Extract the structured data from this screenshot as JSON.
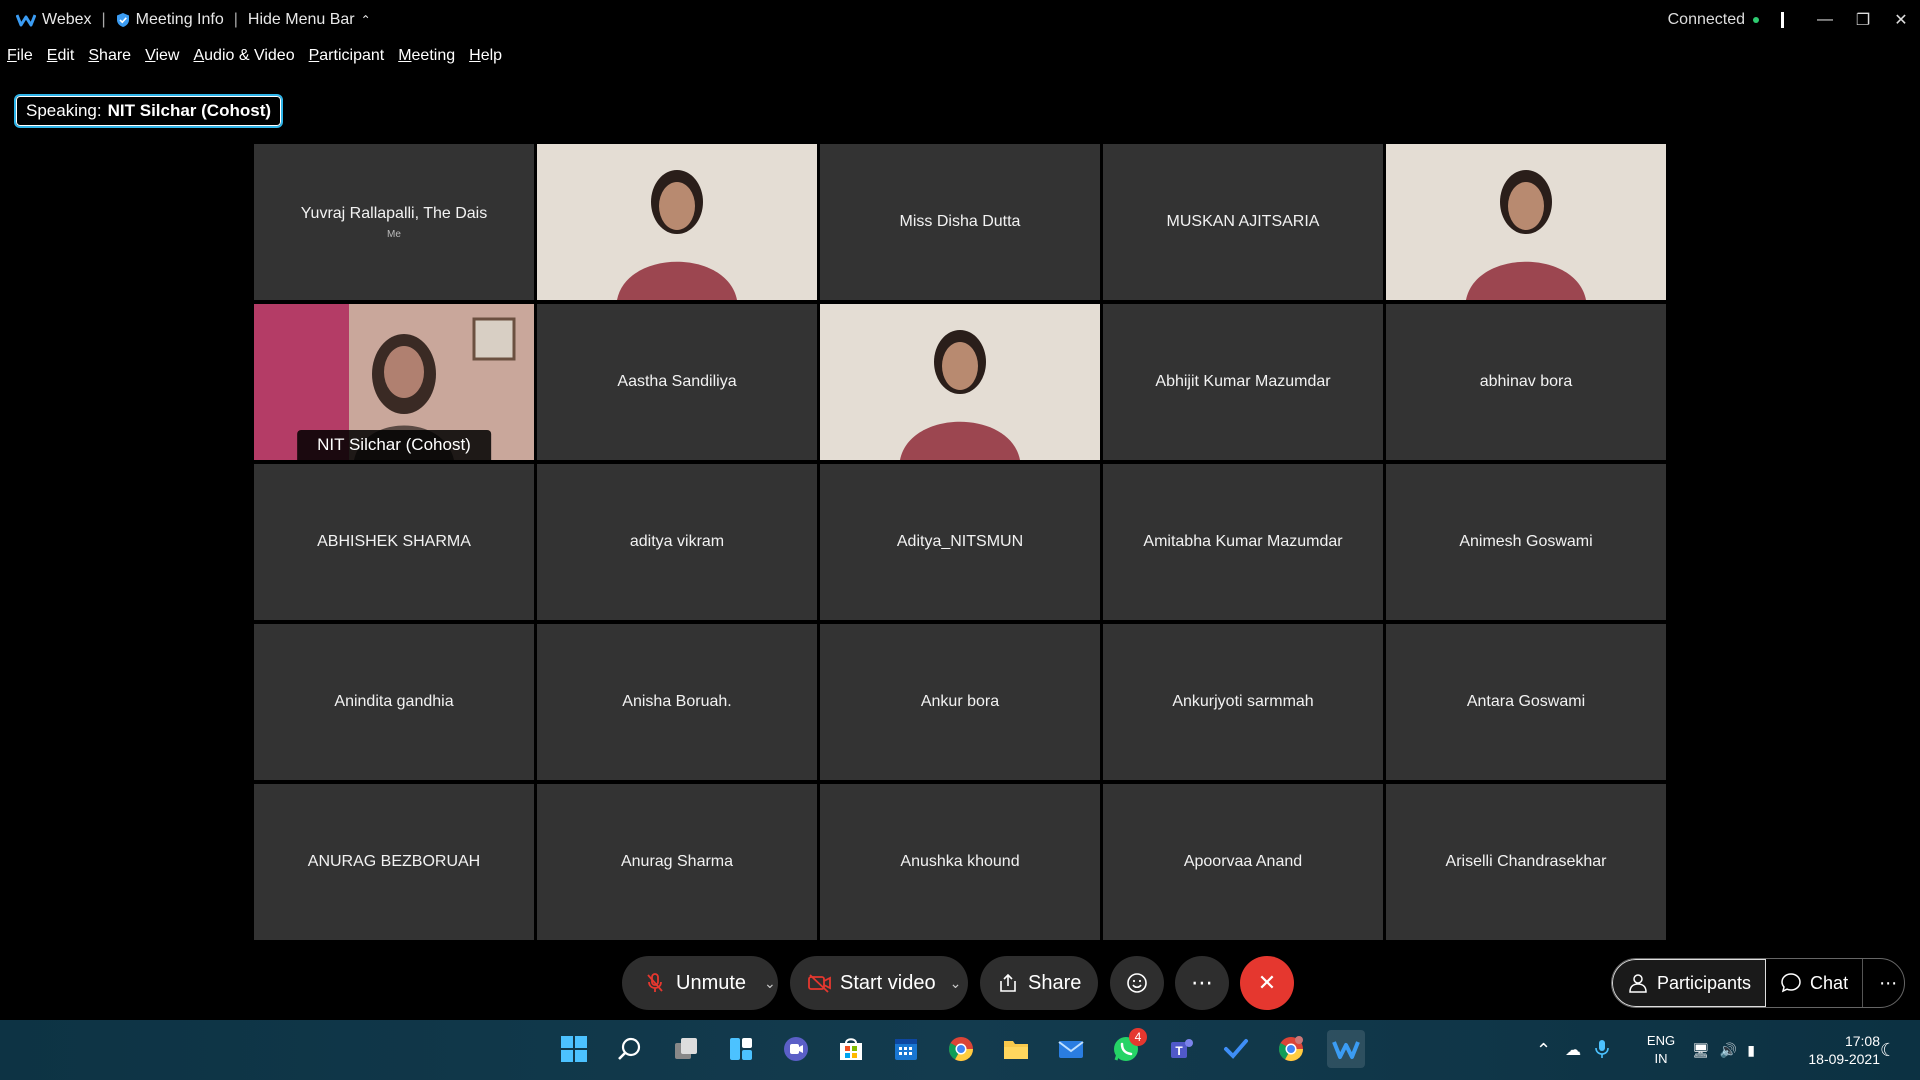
{
  "titlebar": {
    "app": "Webex",
    "meeting_info": "Meeting Info",
    "hide_menu": "Hide Menu Bar",
    "status": "Connected"
  },
  "menu": [
    "File",
    "Edit",
    "Share",
    "View",
    "Audio & Video",
    "Participant",
    "Meeting",
    "Help"
  ],
  "speaking": {
    "label": "Speaking:",
    "name": "NIT Silchar (Cohost)"
  },
  "tiles": [
    {
      "name": "Yuvraj Rallapalli, The Dais",
      "sub": "Me"
    },
    {
      "name": "",
      "video": true
    },
    {
      "name": "Miss Disha Dutta"
    },
    {
      "name": "MUSKAN AJITSARIA"
    },
    {
      "name": "",
      "video": true
    },
    {
      "name": "NIT Silchar  (Cohost)",
      "video": true,
      "active": true
    },
    {
      "name": "Aastha Sandiliya"
    },
    {
      "name": "",
      "video": true
    },
    {
      "name": "Abhijit Kumar Mazumdar"
    },
    {
      "name": "abhinav bora"
    },
    {
      "name": "ABHISHEK SHARMA"
    },
    {
      "name": "aditya vikram"
    },
    {
      "name": "Aditya_NITSMUN"
    },
    {
      "name": "Amitabha Kumar Mazumdar"
    },
    {
      "name": "Animesh Goswami"
    },
    {
      "name": "Anindita gandhia"
    },
    {
      "name": "Anisha Boruah."
    },
    {
      "name": "Ankur bora"
    },
    {
      "name": "Ankurjyoti sarmmah"
    },
    {
      "name": "Antara Goswami"
    },
    {
      "name": "ANURAG BEZBORUAH"
    },
    {
      "name": "Anurag Sharma"
    },
    {
      "name": "Anushka khound"
    },
    {
      "name": "Apoorvaa Anand"
    },
    {
      "name": "Ariselli Chandrasekhar"
    }
  ],
  "controls": {
    "unmute": "Unmute",
    "start_video": "Start video",
    "share": "Share",
    "participants": "Participants",
    "chat": "Chat"
  },
  "taskbar": {
    "lang_top": "ENG",
    "lang_bottom": "IN",
    "time": "17:08",
    "date": "18-09-2021",
    "whatsapp_badge": "4"
  },
  "colors": {
    "accent": "#1fb1e6",
    "tile_bg": "#333333",
    "end_call": "#e5372f",
    "connected_dot": "#2ecc71"
  }
}
